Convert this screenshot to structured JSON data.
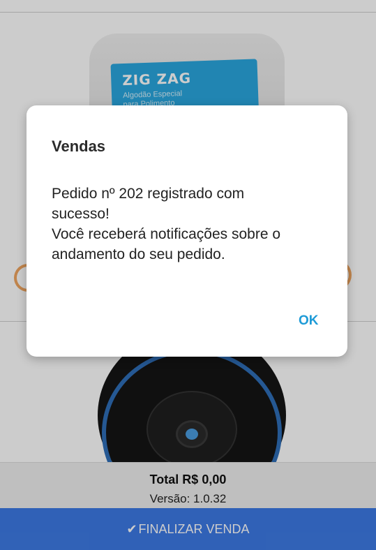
{
  "product_1": {
    "brand": "ZIG ZAG",
    "subtitle": "Algodão Especial\npara Polimento"
  },
  "footer": {
    "total": "Total R$ 0,00",
    "version": "Versão: 1.0.32"
  },
  "finalize_button": {
    "icon": "check-icon",
    "label": "FINALIZAR VENDA"
  },
  "dialog": {
    "title": "Vendas",
    "message": "Pedido nº 202 registrado com\nsucesso!\nVocê receberá notificações sobre o\nandamento do seu pedido.",
    "ok_label": "OK"
  },
  "colors": {
    "primary_button": "#3d7ae5",
    "dialog_action": "#1e9bd7",
    "accent_orange": "#f0a560"
  }
}
